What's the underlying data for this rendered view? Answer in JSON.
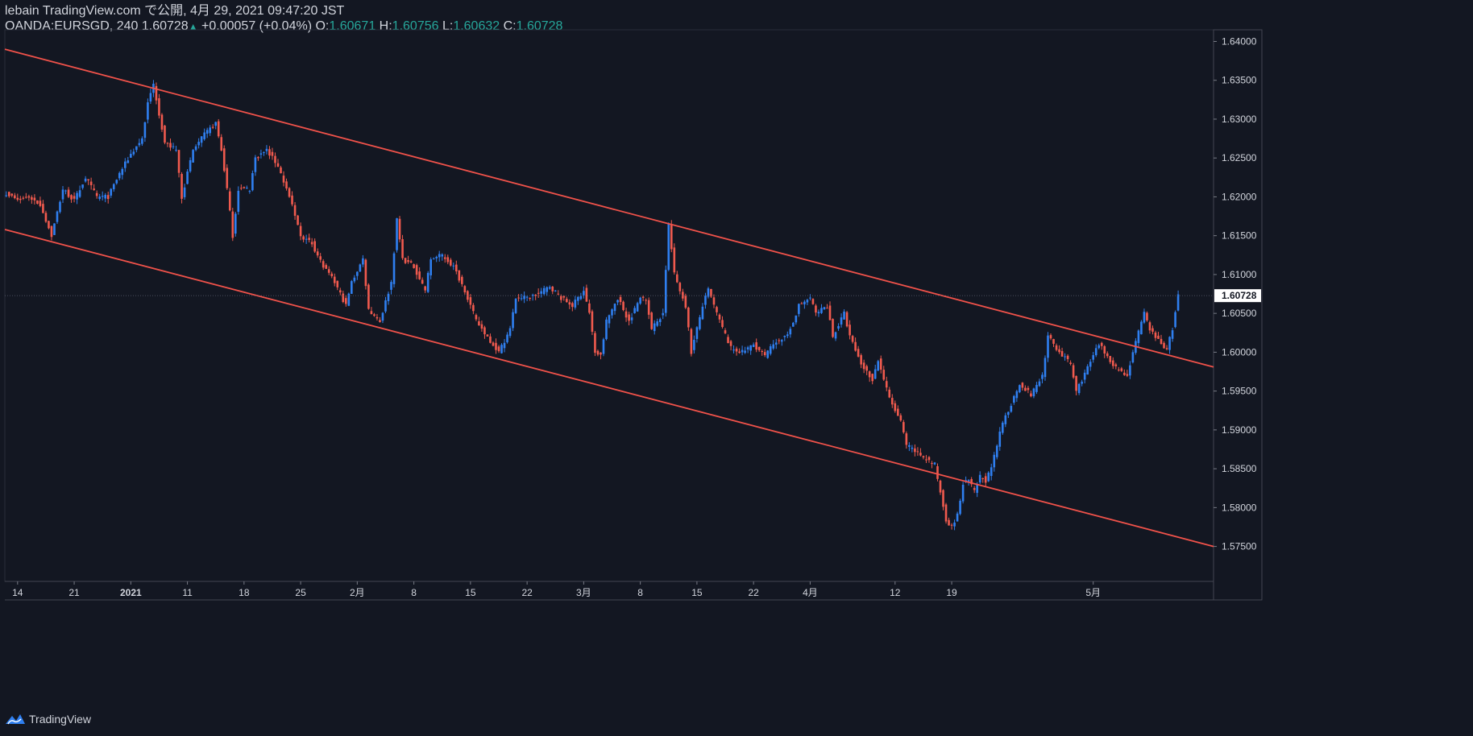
{
  "header": {
    "publish_line": "lebain TradingView.com で公開, 4月 29, 2021 09:47:20 JST",
    "symbol": "OANDA:EURSGD, 240",
    "last": "1.60728",
    "change": "+0.00057 (+0.04%)",
    "o_label": "O:",
    "o_val": "1.60671",
    "h_label": "H:",
    "h_val": "1.60756",
    "l_label": "L:",
    "l_val": "1.60632",
    "c_label": "C:",
    "c_val": "1.60728"
  },
  "brand": {
    "name": "TradingView",
    "icon": "tradingview-logo-icon"
  },
  "colors": {
    "background": "#131722",
    "up": "#2f7ff0",
    "down": "#f05a4e",
    "trendline": "#f0524a",
    "axis_text": "#d1d4dc",
    "price_tag_bg": "#ffffff"
  },
  "chart_data": {
    "type": "candlestick",
    "symbol": "OANDA:EURSGD",
    "interval": "240",
    "y_ticks": [
      "1.64000",
      "1.63500",
      "1.63000",
      "1.62500",
      "1.62000",
      "1.61500",
      "1.61000",
      "1.60500",
      "1.60000",
      "1.59500",
      "1.59000",
      "1.58500",
      "1.58000",
      "1.57500"
    ],
    "ylim": [
      1.5705,
      1.6415
    ],
    "x_ticks": [
      "14",
      "21",
      "2021",
      "11",
      "18",
      "25",
      "2月",
      "8",
      "15",
      "22",
      "3月",
      "8",
      "15",
      "22",
      "4月",
      "12",
      "19",
      "5月"
    ],
    "x_tick_positions": [
      4,
      24,
      44,
      64,
      84,
      104,
      124,
      144,
      164,
      184,
      204,
      224,
      244,
      264,
      284,
      314,
      334,
      384
    ],
    "last_price": "1.60728",
    "last_price_value": 1.60728,
    "path_points": [
      [
        0,
        1.6205
      ],
      [
        4,
        1.6195
      ],
      [
        8,
        1.62
      ],
      [
        12,
        1.619
      ],
      [
        16,
        1.615
      ],
      [
        20,
        1.621
      ],
      [
        24,
        1.6195
      ],
      [
        28,
        1.6225
      ],
      [
        32,
        1.62
      ],
      [
        36,
        1.62
      ],
      [
        40,
        1.623
      ],
      [
        44,
        1.6255
      ],
      [
        48,
        1.6275
      ],
      [
        50,
        1.632
      ],
      [
        52,
        1.6345
      ],
      [
        56,
        1.627
      ],
      [
        60,
        1.626
      ],
      [
        62,
        1.62
      ],
      [
        66,
        1.626
      ],
      [
        70,
        1.628
      ],
      [
        74,
        1.6295
      ],
      [
        76,
        1.626
      ],
      [
        78,
        1.621
      ],
      [
        80,
        1.615
      ],
      [
        82,
        1.621
      ],
      [
        86,
        1.621
      ],
      [
        88,
        1.625
      ],
      [
        92,
        1.626
      ],
      [
        96,
        1.624
      ],
      [
        100,
        1.62
      ],
      [
        104,
        1.615
      ],
      [
        108,
        1.614
      ],
      [
        112,
        1.611
      ],
      [
        116,
        1.609
      ],
      [
        120,
        1.606
      ],
      [
        122,
        1.609
      ],
      [
        126,
        1.612
      ],
      [
        128,
        1.6055
      ],
      [
        132,
        1.604
      ],
      [
        136,
        1.609
      ],
      [
        138,
        1.617
      ],
      [
        140,
        1.612
      ],
      [
        144,
        1.611
      ],
      [
        148,
        1.608
      ],
      [
        150,
        1.612
      ],
      [
        154,
        1.6125
      ],
      [
        158,
        1.611
      ],
      [
        162,
        1.608
      ],
      [
        166,
        1.604
      ],
      [
        170,
        1.602
      ],
      [
        174,
        1.6
      ],
      [
        178,
        1.603
      ],
      [
        180,
        1.607
      ],
      [
        184,
        1.607
      ],
      [
        188,
        1.6075
      ],
      [
        192,
        1.6085
      ],
      [
        196,
        1.607
      ],
      [
        200,
        1.606
      ],
      [
        204,
        1.608
      ],
      [
        206,
        1.605
      ],
      [
        208,
        1.6
      ],
      [
        210,
        1.5995
      ],
      [
        212,
        1.604
      ],
      [
        216,
        1.607
      ],
      [
        220,
        1.604
      ],
      [
        224,
        1.607
      ],
      [
        226,
        1.607
      ],
      [
        228,
        1.603
      ],
      [
        232,
        1.605
      ],
      [
        234,
        1.6165
      ],
      [
        236,
        1.61
      ],
      [
        240,
        1.606
      ],
      [
        242,
        1.6
      ],
      [
        246,
        1.606
      ],
      [
        248,
        1.608
      ],
      [
        252,
        1.604
      ],
      [
        256,
        1.6005
      ],
      [
        260,
        1.6
      ],
      [
        264,
        1.601
      ],
      [
        268,
        1.5995
      ],
      [
        272,
        1.6015
      ],
      [
        276,
        1.602
      ],
      [
        280,
        1.606
      ],
      [
        284,
        1.607
      ],
      [
        286,
        1.605
      ],
      [
        290,
        1.606
      ],
      [
        292,
        1.602
      ],
      [
        296,
        1.605
      ],
      [
        298,
        1.602
      ],
      [
        302,
        1.5985
      ],
      [
        306,
        1.5965
      ],
      [
        308,
        1.599
      ],
      [
        312,
        1.594
      ],
      [
        316,
        1.591
      ],
      [
        318,
        1.588
      ],
      [
        322,
        1.587
      ],
      [
        326,
        1.586
      ],
      [
        328,
        1.5855
      ],
      [
        330,
        1.582
      ],
      [
        332,
        1.5785
      ],
      [
        334,
        1.5775
      ],
      [
        336,
        1.579
      ],
      [
        338,
        1.583
      ],
      [
        340,
        1.5835
      ],
      [
        342,
        1.582
      ],
      [
        344,
        1.584
      ],
      [
        346,
        1.5835
      ],
      [
        348,
        1.585
      ],
      [
        350,
        1.588
      ],
      [
        352,
        1.591
      ],
      [
        354,
        1.5925
      ],
      [
        358,
        1.596
      ],
      [
        362,
        1.5945
      ],
      [
        366,
        1.597
      ],
      [
        368,
        1.602
      ],
      [
        372,
        1.6
      ],
      [
        376,
        1.5985
      ],
      [
        378,
        1.595
      ],
      [
        382,
        1.598
      ],
      [
        386,
        1.601
      ],
      [
        388,
        1.6
      ],
      [
        392,
        1.598
      ],
      [
        396,
        1.597
      ],
      [
        398,
        1.6
      ],
      [
        402,
        1.605
      ],
      [
        404,
        1.603
      ],
      [
        408,
        1.601
      ],
      [
        410,
        1.6005
      ],
      [
        412,
        1.603
      ],
      [
        414,
        1.6073
      ]
    ],
    "trendlines": [
      {
        "name": "upper-channel",
        "from": [
          0,
          1.639
        ],
        "to": [
          427,
          1.5981
        ]
      },
      {
        "name": "lower-channel",
        "from": [
          0,
          1.6158
        ],
        "to": [
          427,
          1.575
        ]
      }
    ]
  }
}
